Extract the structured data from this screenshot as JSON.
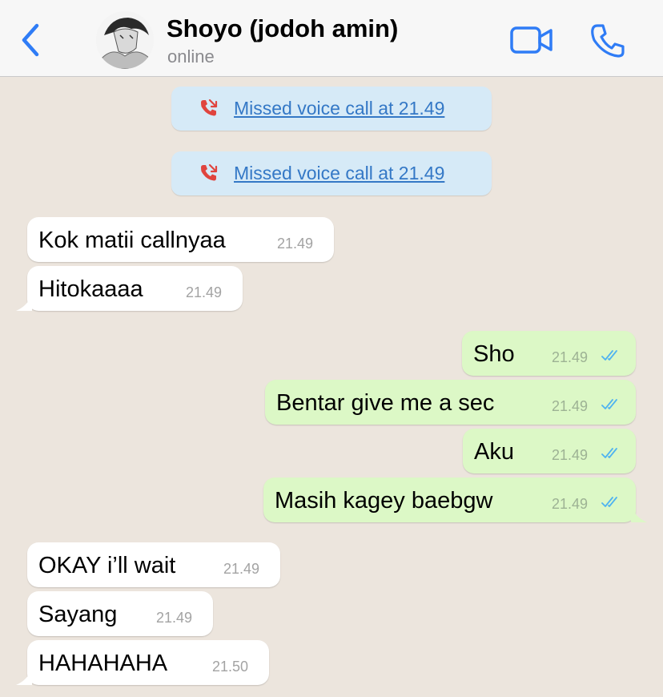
{
  "header": {
    "contact_name": "Shoyo (jodoh amin)",
    "status": "online",
    "accent_color": "#2f7cf6",
    "back_icon": "chevron-left-icon",
    "video_icon": "video-camera-icon",
    "call_icon": "phone-icon"
  },
  "system_messages": [
    {
      "text": "Missed voice call at 21.49",
      "icon": "missed-call-icon"
    },
    {
      "text": "Missed voice call at 21.49",
      "icon": "missed-call-icon"
    }
  ],
  "messages": [
    {
      "direction": "incoming",
      "text": "Kok matii callnyaa",
      "time": "21.49"
    },
    {
      "direction": "incoming",
      "text": "Hitokaaaa",
      "time": "21.49"
    },
    {
      "direction": "outgoing",
      "text": "Sho",
      "time": "21.49",
      "status": "read"
    },
    {
      "direction": "outgoing",
      "text": "Bentar give me a sec",
      "time": "21.49",
      "status": "read"
    },
    {
      "direction": "outgoing",
      "text": "Aku",
      "time": "21.49",
      "status": "read"
    },
    {
      "direction": "outgoing",
      "text": "Masih kagey baebgw",
      "time": "21.49",
      "status": "read"
    },
    {
      "direction": "incoming",
      "text": "OKAY i’ll wait",
      "time": "21.49"
    },
    {
      "direction": "incoming",
      "text": "Sayang",
      "time": "21.49"
    },
    {
      "direction": "incoming",
      "text": "HAHAHAHA",
      "time": "21.50"
    }
  ],
  "colors": {
    "chat_background": "#ece5dd",
    "incoming_bubble": "#ffffff",
    "outgoing_bubble": "#dcf8c6",
    "system_bubble": "#d6eaf7",
    "missed_call": "#e0443e",
    "read_ticks": "#4fb3f0"
  }
}
